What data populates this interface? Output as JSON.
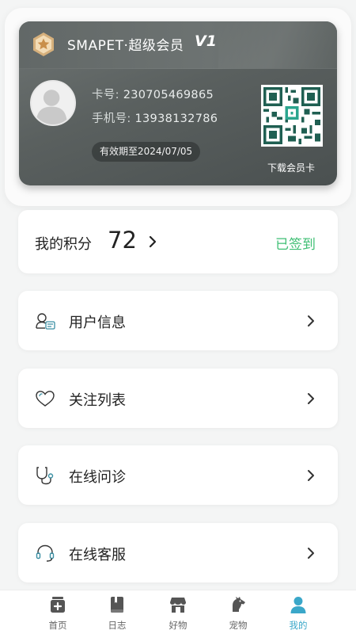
{
  "member_card": {
    "title": "SMAPET·超级会员",
    "level": "V1",
    "card_no_label": "卡号: ",
    "card_no": "230705469865",
    "phone_label": "手机号: ",
    "phone": "13938132786",
    "validity": "有效期至2024/07/05",
    "download_label": "下载会员卡",
    "badge_icon": "star-medal-icon",
    "accent": "#5f6564"
  },
  "points": {
    "label": "我的积分",
    "value": "72",
    "status": "已签到",
    "status_color": "#3fbf74"
  },
  "menu": [
    {
      "label": "用户信息",
      "icon": "user-card-icon"
    },
    {
      "label": "关注列表",
      "icon": "heart-icon"
    },
    {
      "label": "在线问诊",
      "icon": "stethoscope-icon"
    },
    {
      "label": "在线客服",
      "icon": "headset-icon"
    }
  ],
  "tabs": [
    {
      "label": "首页",
      "icon": "home-box-icon",
      "active": false
    },
    {
      "label": "日志",
      "icon": "diary-icon",
      "active": false
    },
    {
      "label": "好物",
      "icon": "store-icon",
      "active": false
    },
    {
      "label": "宠物",
      "icon": "dog-icon",
      "active": false
    },
    {
      "label": "我的",
      "icon": "profile-icon",
      "active": true
    }
  ],
  "colors": {
    "active_tab": "#3aa7c9",
    "icon_teal": "#3a8fa3"
  }
}
